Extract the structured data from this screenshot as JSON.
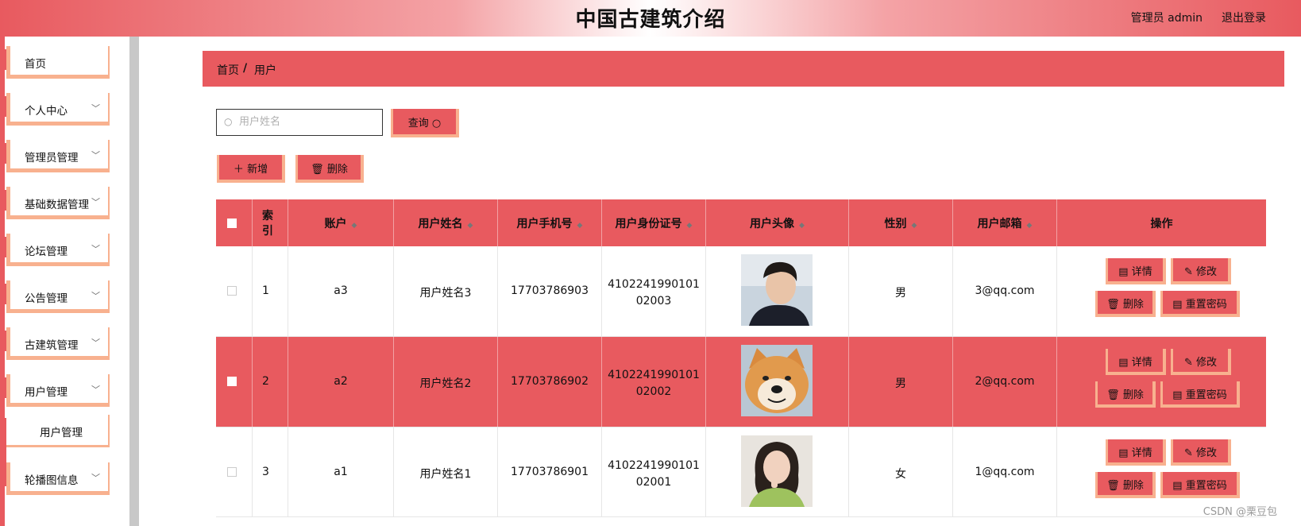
{
  "header": {
    "title": "中国古建筑介绍",
    "admin_label": "管理员 admin",
    "logout_label": "退出登录"
  },
  "sidebar": {
    "items": [
      {
        "label": "首页",
        "has_chevron": false
      },
      {
        "label": "个人中心",
        "has_chevron": true
      },
      {
        "label": "管理员管理",
        "has_chevron": true
      },
      {
        "label": "基础数据管理",
        "has_chevron": true
      },
      {
        "label": "论坛管理",
        "has_chevron": true
      },
      {
        "label": "公告管理",
        "has_chevron": true
      },
      {
        "label": "古建筑管理",
        "has_chevron": true
      },
      {
        "label": "用户管理",
        "has_chevron": true
      },
      {
        "label": "轮播图信息",
        "has_chevron": true
      }
    ],
    "subitem": "用户管理"
  },
  "breadcrumb": {
    "home": "首页",
    "separator": "/",
    "current": "用户"
  },
  "search": {
    "placeholder": "用户姓名",
    "query_button": "查询"
  },
  "toolbar": {
    "add_label": "新增",
    "delete_label": "删除"
  },
  "table": {
    "headers": [
      "索引",
      "账户",
      "用户姓名",
      "用户手机号",
      "用户身份证号",
      "用户头像",
      "性别",
      "用户邮箱",
      "操作"
    ],
    "rows": [
      {
        "index": "1",
        "account": "a3",
        "name": "用户姓名3",
        "phone": "17703786903",
        "id_line1": "4102241990101",
        "id_line2": "02003",
        "avatar": "young man portrait",
        "gender": "男",
        "email": "3@qq.com"
      },
      {
        "index": "2",
        "account": "a2",
        "name": "用户姓名2",
        "phone": "17703786902",
        "id_line1": "4102241990101",
        "id_line2": "02002",
        "avatar": "shiba inu dog",
        "gender": "男",
        "email": "2@qq.com"
      },
      {
        "index": "3",
        "account": "a1",
        "name": "用户姓名1",
        "phone": "17703786901",
        "id_line1": "4102241990101",
        "id_line2": "02001",
        "avatar": "young woman portrait",
        "gender": "女",
        "email": "1@qq.com"
      }
    ],
    "actions": {
      "detail": "详情",
      "edit": "修改",
      "delete": "删除",
      "reset": "重置密码"
    }
  },
  "watermark": "CSDN @栗豆包",
  "colors": {
    "primary": "#e85a5f",
    "accent": "#f8b18f"
  }
}
